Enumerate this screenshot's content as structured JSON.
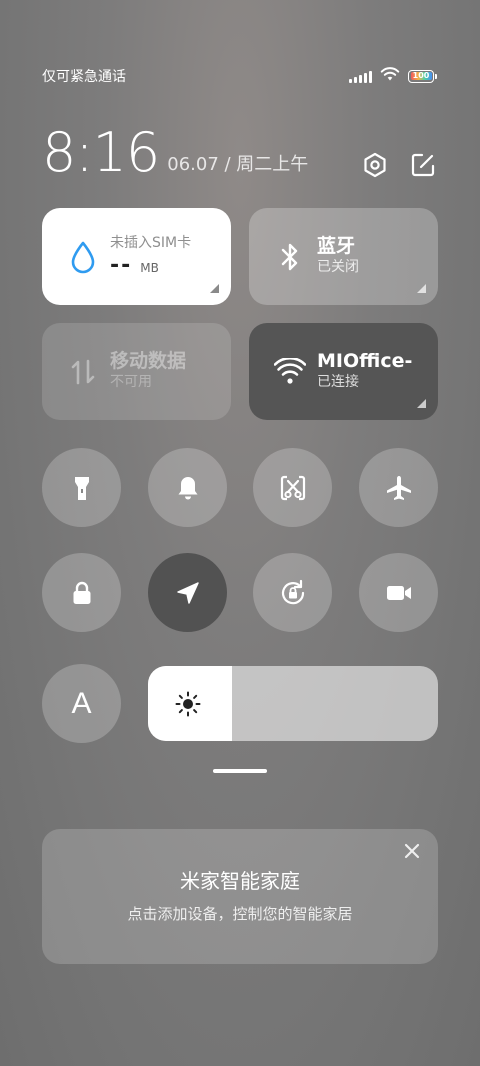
{
  "status_bar": {
    "carrier": "仅可紧急通话",
    "battery": "100"
  },
  "header": {
    "time": "8:16",
    "date": "06.07 / 周二上午"
  },
  "tiles": {
    "data": {
      "title": "未插入SIM卡",
      "value": "--",
      "unit": "MB",
      "accent": "#2f9bf0"
    },
    "bluetooth": {
      "title": "蓝牙",
      "status": "已关闭"
    },
    "mobile_data": {
      "title": "移动数据",
      "status": "不可用"
    },
    "wifi": {
      "title": "MIOffice-",
      "status": "已连接"
    }
  },
  "toggles_row1": [
    {
      "name": "flashlight-icon",
      "active": false
    },
    {
      "name": "bell-icon",
      "active": false
    },
    {
      "name": "screenshot-icon",
      "active": false
    },
    {
      "name": "airplane-icon",
      "active": false
    }
  ],
  "toggles_row2": [
    {
      "name": "lock-icon",
      "active": false
    },
    {
      "name": "location-icon",
      "active": true
    },
    {
      "name": "rotation-lock-icon",
      "active": false
    },
    {
      "name": "video-camera-icon",
      "active": false
    }
  ],
  "auto_brightness": {
    "label": "A"
  },
  "brightness": {
    "level": 0.29
  },
  "mijia_card": {
    "title": "米家智能家庭",
    "subtitle": "点击添加设备，控制您的智能家居"
  }
}
